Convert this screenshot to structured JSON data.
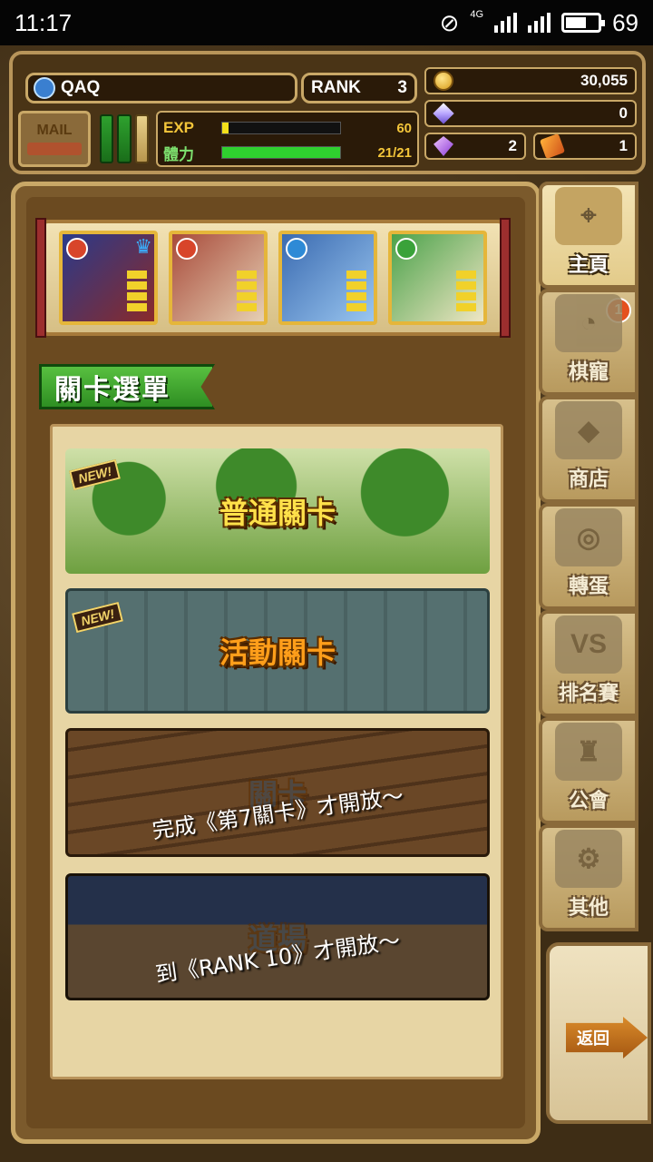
{
  "status_bar": {
    "time": "11:17",
    "network": "4G",
    "battery": "69",
    "battery_level": 0.69
  },
  "player": {
    "name": "QAQ",
    "rank_label": "RANK",
    "rank_value": "3",
    "mail_label": "MAIL"
  },
  "stats": {
    "exp_label": "EXP",
    "exp_value": "60",
    "exp_fill": 0.05,
    "stamina_label": "體力",
    "stamina_value": "21/21",
    "stamina_fill": 1.0
  },
  "resources": {
    "gold": "30,055",
    "crystal": "0",
    "gem": "2",
    "ticket": "1"
  },
  "party": [
    {
      "name": "blue-haired-girl",
      "element": "fire",
      "leader": true
    },
    {
      "name": "red-wolf",
      "element": "fire",
      "leader": false
    },
    {
      "name": "blue-dragon",
      "element": "water",
      "leader": false
    },
    {
      "name": "green-plant-creature",
      "element": "wood",
      "leader": false
    }
  ],
  "menu_title": "關卡選單",
  "stages": {
    "normal": {
      "title": "普通關卡",
      "badge": "NEW!"
    },
    "event": {
      "title": "活動關卡",
      "badge": "NEW!"
    },
    "locked1": {
      "title": "關卡",
      "lock_text": "完成《第7關卡》才開放～"
    },
    "locked2": {
      "title": "道場",
      "lock_text": "到《RANK 10》才開放～"
    }
  },
  "nav": {
    "home": "主頁",
    "pets": "棋寵",
    "pets_badge": "1",
    "shop": "商店",
    "gacha": "轉蛋",
    "ranking": "排名賽",
    "ranking_icon_text": "VS",
    "guild": "公會",
    "other": "其他",
    "back": "返回"
  },
  "colors": {
    "fire": "#d8452a",
    "water": "#2e8ad6",
    "wood": "#3aa23a",
    "exp_fill": "#f3e01a",
    "stamina_fill": "#2fd02f"
  }
}
